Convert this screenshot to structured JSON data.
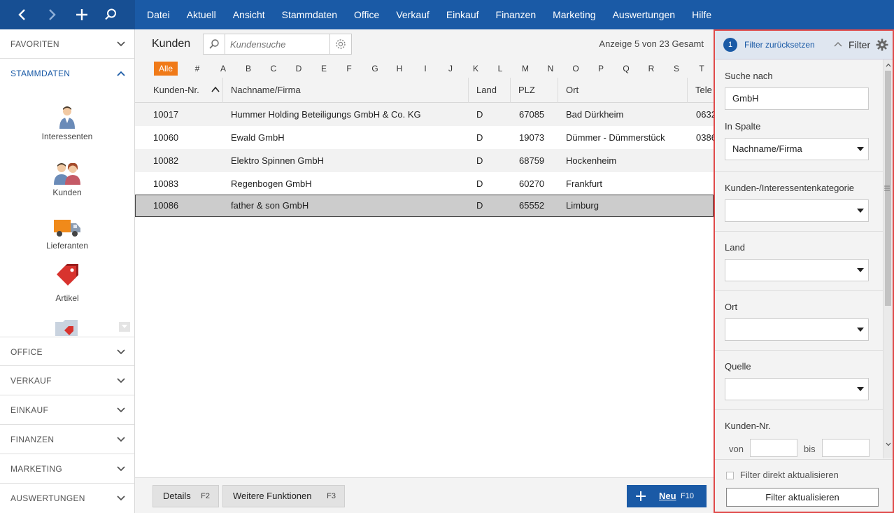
{
  "menu": [
    "Datei",
    "Aktuell",
    "Ansicht",
    "Stammdaten",
    "Office",
    "Verkauf",
    "Einkauf",
    "Finanzen",
    "Marketing",
    "Auswertungen",
    "Hilfe"
  ],
  "sidebar": {
    "favoriten": "FAVORITEN",
    "stammdaten": "STAMMDATEN",
    "items": [
      {
        "label": "Interessenten",
        "icon": "person-icon"
      },
      {
        "label": "Kunden",
        "icon": "couple-icon"
      },
      {
        "label": "Lieferanten",
        "icon": "truck-icon"
      },
      {
        "label": "Artikel",
        "icon": "tag-icon"
      }
    ],
    "sections": [
      "OFFICE",
      "VERKAUF",
      "EINKAUF",
      "FINANZEN",
      "MARKETING",
      "AUSWERTUNGEN"
    ]
  },
  "main": {
    "title": "Kunden",
    "search_placeholder": "Kundensuche",
    "count_info": "Anzeige 5 von 23 Gesamt",
    "alpha": [
      "Alle",
      "#",
      "A",
      "B",
      "C",
      "D",
      "E",
      "F",
      "G",
      "H",
      "I",
      "J",
      "K",
      "L",
      "M",
      "N",
      "O",
      "P",
      "Q",
      "R",
      "S",
      "T"
    ],
    "columns": [
      "Kunden-Nr.",
      "Nachname/Firma",
      "Land",
      "PLZ",
      "Ort",
      "Tele"
    ],
    "rows": [
      {
        "nr": "10017",
        "name": "Hummer Holding Beteiligungs GmbH & Co. KG",
        "land": "D",
        "plz": "67085",
        "ort": "Bad Dürkheim",
        "tel": "0632"
      },
      {
        "nr": "10060",
        "name": "Ewald GmbH",
        "land": "D",
        "plz": "19073",
        "ort": "Dümmer - Dümmerstück",
        "tel": "0386"
      },
      {
        "nr": "10082",
        "name": "Elektro Spinnen GmbH",
        "land": "D",
        "plz": "68759",
        "ort": "Hockenheim",
        "tel": ""
      },
      {
        "nr": "10083",
        "name": "Regenbogen GmbH",
        "land": "D",
        "plz": "60270",
        "ort": "Frankfurt",
        "tel": ""
      },
      {
        "nr": "10086",
        "name": "father & son GmbH",
        "land": "D",
        "plz": "65552",
        "ort": "Limburg",
        "tel": ""
      }
    ],
    "buttons": {
      "details": "Details",
      "details_key": "F2",
      "weitere": "Weitere Funktionen",
      "weitere_key": "F3",
      "neu": "Neu",
      "neu_key": "F10"
    }
  },
  "filter": {
    "badge": "1",
    "reset": "Filter zurücksetzen",
    "title": "Filter",
    "suche_nach_label": "Suche nach",
    "suche_nach_value": "GmbH",
    "in_spalte_label": "In Spalte",
    "in_spalte_value": "Nachname/Firma",
    "kategorie_label": "Kunden-/Interessentenkategorie",
    "land_label": "Land",
    "ort_label": "Ort",
    "quelle_label": "Quelle",
    "kundennr_label": "Kunden-Nr.",
    "von": "von",
    "bis": "bis",
    "direkt_label": "Filter direkt aktualisieren",
    "apply_label": "Filter aktualisieren"
  },
  "colors": {
    "brand": "#1a5aa6",
    "accent": "#f07a18",
    "highlight": "#e04a4a"
  }
}
